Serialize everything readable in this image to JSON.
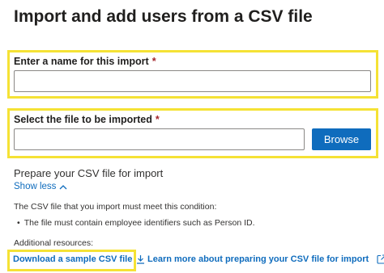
{
  "page": {
    "title": "Import and add users from a CSV file"
  },
  "form": {
    "name_label": "Enter a name for this import",
    "name_value": "",
    "required_marker": "*",
    "file_label": "Select the file to be imported",
    "file_value": "",
    "browse_label": "Browse"
  },
  "prepare": {
    "title": "Prepare your CSV file for import",
    "toggle_label": "Show less",
    "condition_text": "The CSV file that you import must meet this condition:",
    "bullets": [
      "The file must contain employee identifiers such as Person ID."
    ],
    "resources_label": "Additional resources:",
    "sample_link": "Download a sample CSV file",
    "learn_link": "Learn more about preparing your CSV file for import"
  },
  "icons": {
    "toggle": "chevron-up-icon",
    "sample": "download-icon",
    "learn": "external-link-icon"
  },
  "colors": {
    "accent": "#0f6cbd",
    "highlight": "#f5e235",
    "required": "#a4262c"
  }
}
